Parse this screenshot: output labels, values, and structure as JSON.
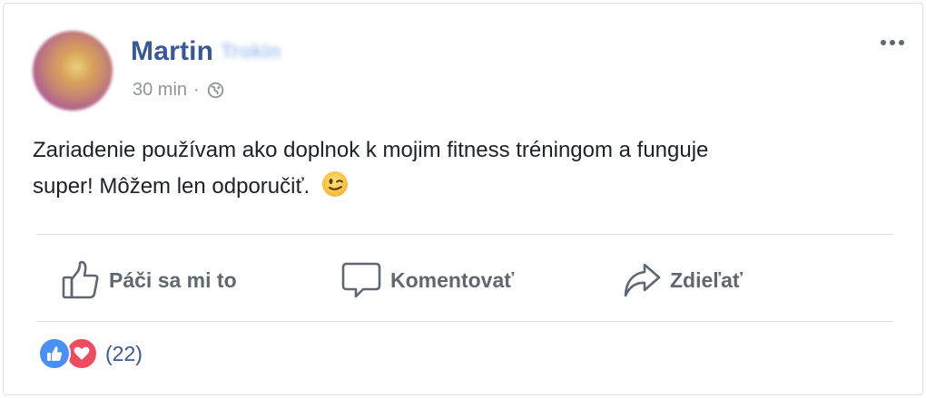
{
  "post": {
    "author_first_name": "Martin",
    "author_last_name_blurred": "Trokin",
    "timestamp": "30 min",
    "separator": "·",
    "privacy_icon": "globe-icon",
    "options_icon": "more-options-icon",
    "text_line1": "Zariadenie používam ako doplnok k mojim fitness tréningom a funguje",
    "text_line2": "super! Môžem len odporučiť.",
    "emoji": "wink-emoji"
  },
  "actions": {
    "like_label": "Páči sa mi to",
    "comment_label": "Komentovať",
    "share_label": "Zdieľať"
  },
  "reactions": {
    "icons": [
      "like-reaction-icon",
      "love-reaction-icon"
    ],
    "count": "(22)"
  },
  "colors": {
    "author": "#385898",
    "meta": "#90949c",
    "text": "#1d2129",
    "action": "#606770",
    "like": "#4a8ef7",
    "love": "#ef4b5f",
    "divider": "#dadde1"
  }
}
